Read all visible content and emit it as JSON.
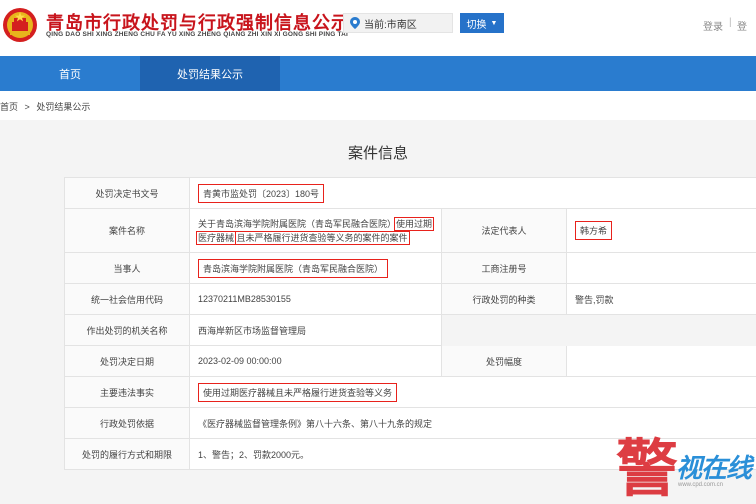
{
  "header": {
    "title": "青岛市行政处罚与行政强制信息公示平台",
    "subtitle": "QING DAO SHI XING ZHENG CHU FA YU XING ZHENG QIANG ZHI XIN XI GONG SHI PING TAI",
    "location_prefix": "当前:",
    "location_value": "市南区",
    "switch_label": "切换",
    "login_label": "登录",
    "login_sep": "|",
    "login_right": "登"
  },
  "nav": {
    "home": "首页",
    "active": "处罚结果公示"
  },
  "breadcrumb": {
    "home": "首页",
    "sep": ">",
    "current": "处罚结果公示"
  },
  "case": {
    "title": "案件信息",
    "decision_no_label": "处罚决定书文号",
    "decision_no": "青黄市监处罚〔2023〕180号",
    "case_name_label": "案件名称",
    "case_name_part1": "关于青岛滨海学院附属医院（青岛军民融合医院）",
    "case_name_part2": "使用过期",
    "case_name_part3": "医疗器械",
    "case_name_part4": "且未严格履行进货查验等义务的案件的案件",
    "legal_rep_label": "法定代表人",
    "legal_rep": "韩方希",
    "party_label": "当事人",
    "party": "青岛滨海学院附属医院（青岛军民融合医院）",
    "biz_reg_label": "工商注册号",
    "biz_reg": "",
    "credit_code_label": "统一社会信用代码",
    "credit_code": "12370211MB28530155",
    "penalty_type_label": "行政处罚的种类",
    "penalty_type": "警告,罚款",
    "authority_label": "作出处罚的机关名称",
    "authority": "西海岸新区市场监督管理局",
    "decision_date_label": "处罚决定日期",
    "decision_date": "2023-02-09 00:00:00",
    "penalty_range_label": "处罚幅度",
    "penalty_range": "",
    "violation_label": "主要违法事实",
    "violation": "使用过期医疗器械且未严格履行进货查验等义务",
    "basis_label": "行政处罚依据",
    "basis": "《医疗器械监督管理条例》第八十六条、第八十九条的规定",
    "execution_label": "处罚的履行方式和期限",
    "execution": "1、警告；2、罚款2000元。"
  },
  "watermark": {
    "char": "警",
    "text": "视在线",
    "url": "www.cpd.com.cn"
  },
  "colors": {
    "brand_red": "#c8141c",
    "nav_blue": "#2a7ccf",
    "nav_active": "#1f63b0",
    "highlight_red": "#e8221c"
  }
}
